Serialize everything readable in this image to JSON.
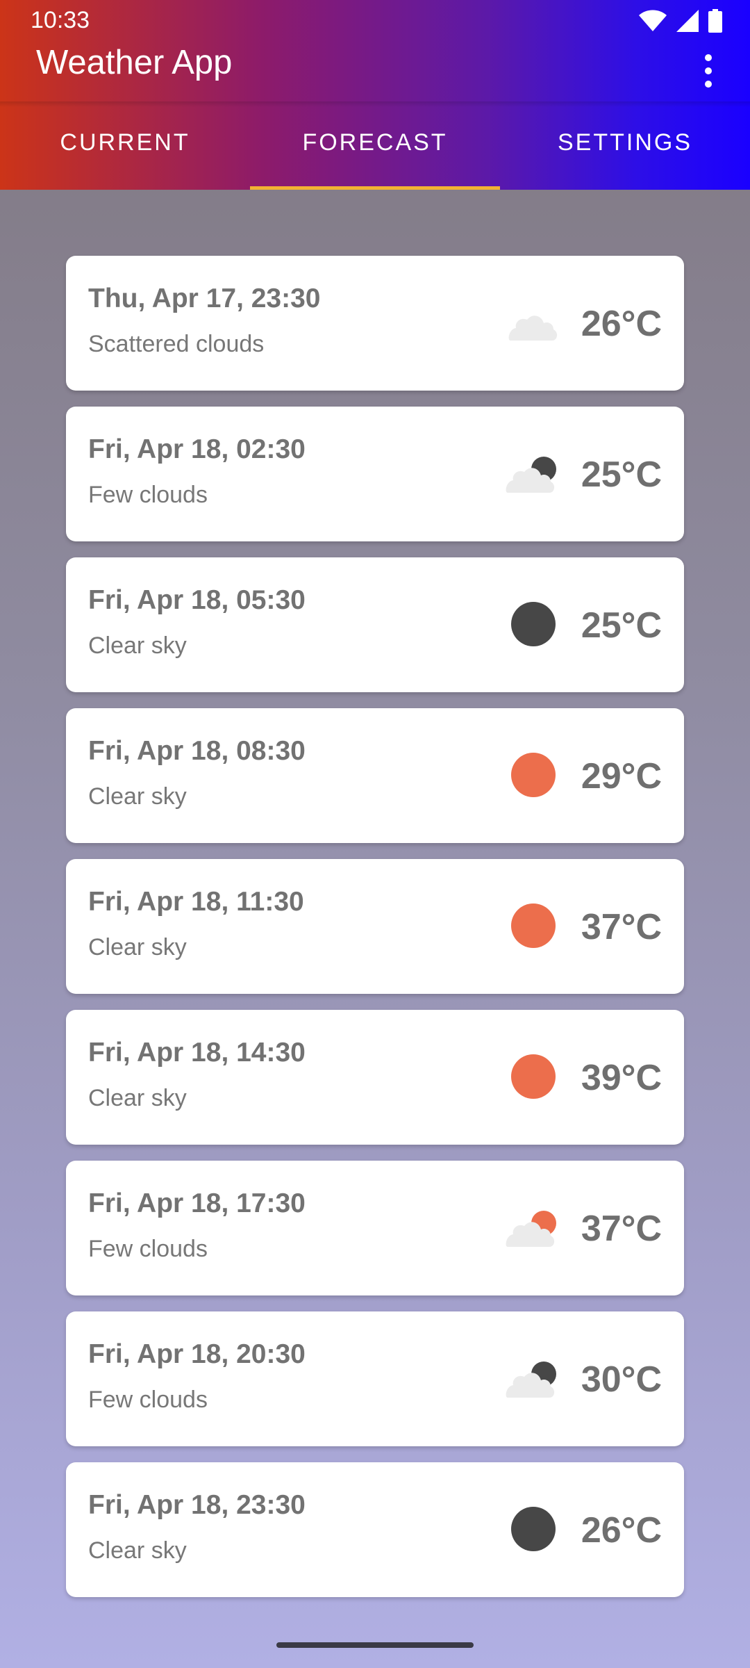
{
  "status_bar": {
    "time": "10:33"
  },
  "app_bar": {
    "title": "Weather App"
  },
  "tabs": [
    {
      "label": "CURRENT"
    },
    {
      "label": "FORECAST"
    },
    {
      "label": "SETTINGS"
    }
  ],
  "forecast": [
    {
      "datetime": "Thu, Apr 17, 23:30",
      "description": "Scattered clouds",
      "temp": "26°C",
      "icon": "cloud-icon"
    },
    {
      "datetime": "Fri, Apr 18, 02:30",
      "description": "Few clouds",
      "temp": "25°C",
      "icon": "cloud-moon-icon"
    },
    {
      "datetime": "Fri, Apr 18, 05:30",
      "description": "Clear sky",
      "temp": "25°C",
      "icon": "moon-icon"
    },
    {
      "datetime": "Fri, Apr 18, 08:30",
      "description": "Clear sky",
      "temp": "29°C",
      "icon": "sun-icon"
    },
    {
      "datetime": "Fri, Apr 18, 11:30",
      "description": "Clear sky",
      "temp": "37°C",
      "icon": "sun-icon"
    },
    {
      "datetime": "Fri, Apr 18, 14:30",
      "description": "Clear sky",
      "temp": "39°C",
      "icon": "sun-icon"
    },
    {
      "datetime": "Fri, Apr 18, 17:30",
      "description": "Few clouds",
      "temp": "37°C",
      "icon": "cloud-sun-icon"
    },
    {
      "datetime": "Fri, Apr 18, 20:30",
      "description": "Few clouds",
      "temp": "30°C",
      "icon": "cloud-moon-icon"
    },
    {
      "datetime": "Fri, Apr 18, 23:30",
      "description": "Clear sky",
      "temp": "26°C",
      "icon": "moon-icon"
    }
  ],
  "colors": {
    "sun": "#ec6e4c",
    "moon": "#474747",
    "cloud": "#ebebeb",
    "tab_indicator": "#f2b233"
  }
}
